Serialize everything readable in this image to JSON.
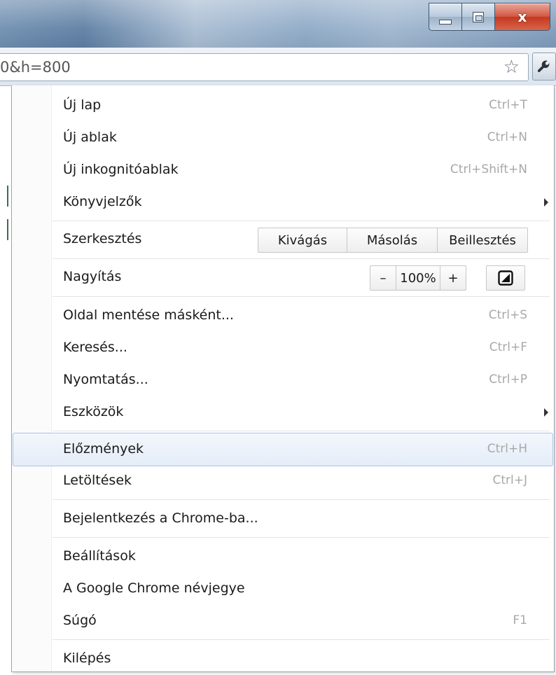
{
  "window": {
    "controls": {
      "minimize_icon": "minimize-icon",
      "maximize_icon": "maximize-icon",
      "close_icon": "close-icon",
      "close_glyph": "x"
    }
  },
  "toolbar": {
    "url_text": "0&h=800",
    "star_icon": "star-icon",
    "wrench_icon": "wrench-icon"
  },
  "menu": {
    "new_tab": {
      "label": "Új lap",
      "shortcut": "Ctrl+T"
    },
    "new_window": {
      "label": "Új ablak",
      "shortcut": "Ctrl+N"
    },
    "new_incognito": {
      "label": "Új inkognitóablak",
      "shortcut": "Ctrl+Shift+N"
    },
    "bookmarks": {
      "label": "Könyvjelzők"
    },
    "edit": {
      "label": "Szerkesztés",
      "cut": "Kivágás",
      "copy": "Másolás",
      "paste": "Beillesztés"
    },
    "zoom": {
      "label": "Nagyítás",
      "minus": "–",
      "value": "100%",
      "plus": "+"
    },
    "save_page": {
      "label": "Oldal mentése másként...",
      "shortcut": "Ctrl+S"
    },
    "find": {
      "label": "Keresés...",
      "shortcut": "Ctrl+F"
    },
    "print": {
      "label": "Nyomtatás...",
      "shortcut": "Ctrl+P"
    },
    "tools": {
      "label": "Eszközök"
    },
    "history": {
      "label": "Előzmények",
      "shortcut": "Ctrl+H"
    },
    "downloads": {
      "label": "Letöltések",
      "shortcut": "Ctrl+J"
    },
    "sign_in": {
      "label": "Bejelentkezés a Chrome-ba..."
    },
    "settings": {
      "label": "Beállítások"
    },
    "about": {
      "label": "A Google Chrome névjegye"
    },
    "help": {
      "label": "Súgó",
      "shortcut": "F1"
    },
    "exit": {
      "label": "Kilépés"
    }
  },
  "colors": {
    "highlight_border": "#a8c5e6",
    "shortcut_text": "#a8a8a8",
    "close_button": "#c4381f"
  }
}
